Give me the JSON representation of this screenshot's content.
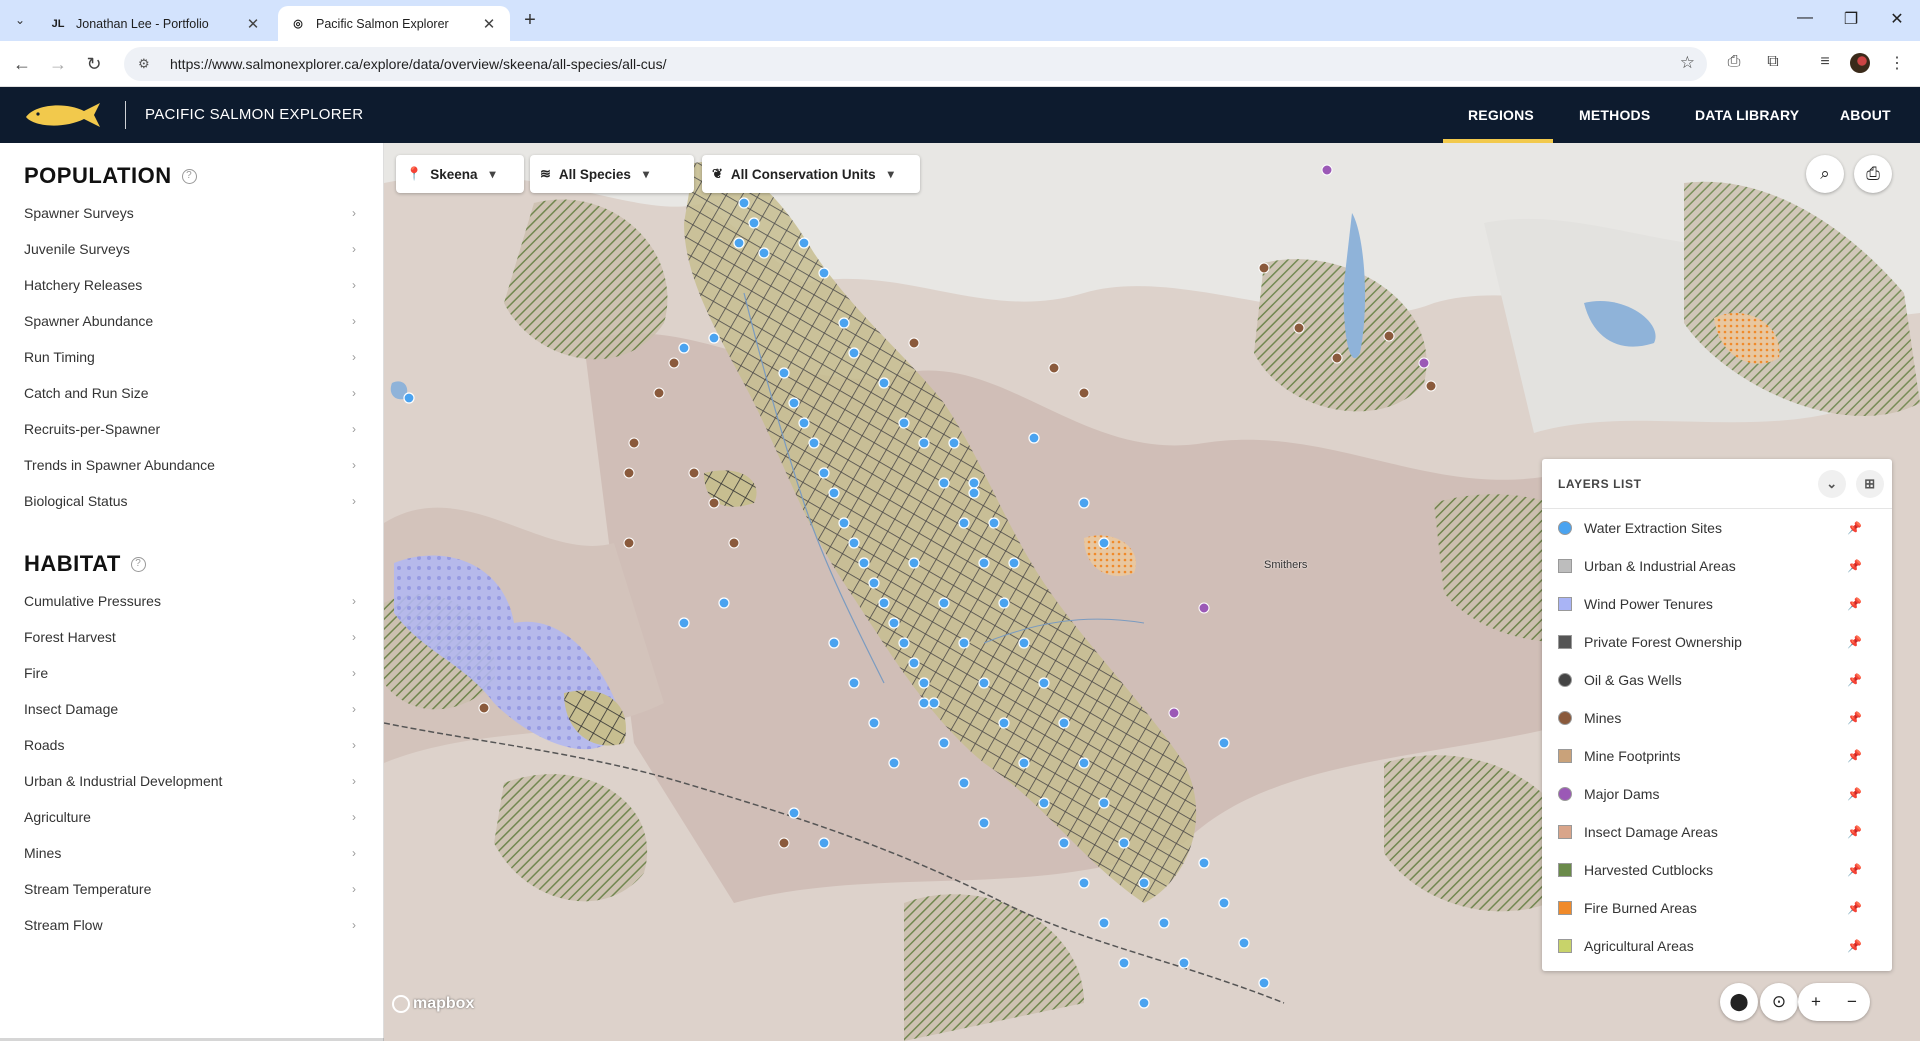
{
  "browser": {
    "tabs": [
      {
        "title": "Jonathan Lee - Portfolio",
        "favicon": "JL"
      },
      {
        "title": "Pacific Salmon Explorer",
        "favicon": "globe-icon"
      }
    ],
    "url": "https://www.salmonexplorer.ca/explore/data/overview/skeena/all-species/all-cus/"
  },
  "header": {
    "site_name": "PACIFIC SALMON EXPLORER",
    "nav": [
      "REGIONS",
      "METHODS",
      "DATA LIBRARY",
      "ABOUT"
    ],
    "active_nav": "REGIONS",
    "accent": "#f2c94c",
    "bg": "#0d1b2e"
  },
  "sidebar": {
    "population": {
      "title": "POPULATION",
      "items": [
        "Spawner Surveys",
        "Juvenile Surveys",
        "Hatchery Releases",
        "Spawner Abundance",
        "Run Timing",
        "Catch and Run Size",
        "Recruits-per-Spawner",
        "Trends in Spawner Abundance",
        "Biological Status"
      ]
    },
    "habitat": {
      "title": "HABITAT",
      "items": [
        "Cumulative Pressures",
        "Forest Harvest",
        "Fire",
        "Insect Damage",
        "Roads",
        "Urban & Industrial Development",
        "Agriculture",
        "Mines",
        "Stream Temperature",
        "Stream Flow"
      ]
    }
  },
  "filters": {
    "region": "Skeena",
    "species": "All Species",
    "cu": "All Conservation Units"
  },
  "map": {
    "town_label": "Smithers",
    "attribution": "mapbox"
  },
  "layers": {
    "title": "LAYERS LIST",
    "items": [
      {
        "label": "Water Extraction Sites",
        "color": "#4aa3f0"
      },
      {
        "label": "Urban & Industrial Areas",
        "color": "#bdbdbd"
      },
      {
        "label": "Wind Power Tenures",
        "color": "#a9b4f5"
      },
      {
        "label": "Private Forest Ownership",
        "color": "#555555"
      },
      {
        "label": "Oil & Gas Wells",
        "color": "#444444"
      },
      {
        "label": "Mines",
        "color": "#8a5a3c"
      },
      {
        "label": "Mine Footprints",
        "color": "#c9a27a"
      },
      {
        "label": "Major Dams",
        "color": "#9b59b6"
      },
      {
        "label": "Insect Damage Areas",
        "color": "#d9a58a"
      },
      {
        "label": "Harvested Cutblocks",
        "color": "#6a8a4a"
      },
      {
        "label": "Fire Burned Areas",
        "color": "#f08a2a"
      },
      {
        "label": "Agricultural Areas",
        "color": "#c8d36a"
      }
    ]
  }
}
